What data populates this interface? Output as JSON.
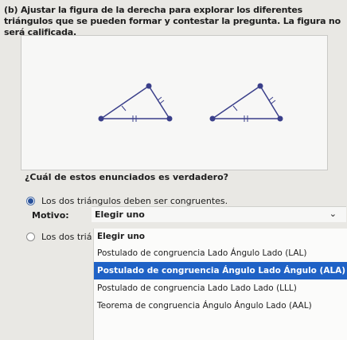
{
  "question": {
    "label": "(b)",
    "text": "Ajustar la figura de la derecha para explorar los diferentes triángulos que se pueden formar y contestar la pregunta. La figura no será calificada."
  },
  "prompt": "¿Cuál de estos enunciados es verdadero?",
  "options": [
    {
      "label": "Los dos triángulos deben ser congruentes.",
      "selected": true
    },
    {
      "label": "Los dos triá",
      "selected": false
    }
  ],
  "motivo": {
    "label": "Motivo:",
    "selected": "Elegir uno"
  },
  "dropdown": {
    "header": "Elegir uno",
    "items": [
      "Postulado de congruencia Lado Ángulo Lado (LAL)",
      "Postulado de congruencia Ángulo Lado Ángulo (ALA)",
      "Postulado de congruencia Lado Lado Lado (LLL)",
      "Teorema de congruencia Ángulo Ángulo Lado (AAL)"
    ],
    "highlighted_index": 1
  },
  "colors": {
    "accent": "#1f62c6",
    "triangle": "#3a3f8a"
  }
}
